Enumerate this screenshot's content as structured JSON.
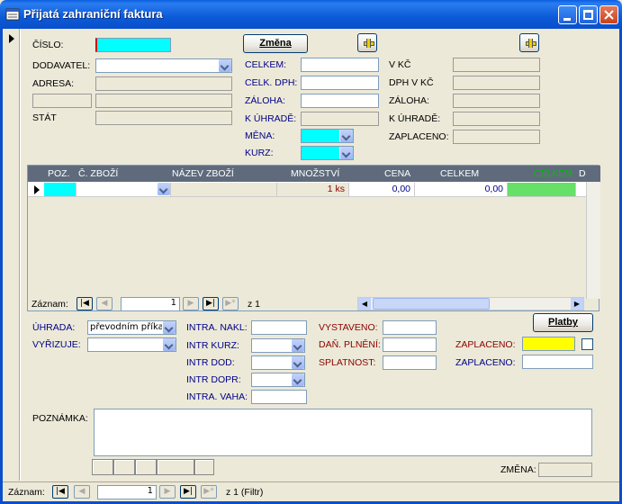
{
  "window": {
    "title": "Přijatá zahraniční faktura"
  },
  "header_left": {
    "cislo_label": "ČÍSLO:",
    "dodavatel_label": "DODAVATEL:",
    "adresa_label": "ADRESA:",
    "stat_label": "STÁT"
  },
  "header_mid": {
    "zmena_button": "Změna",
    "celkem_label": "CELKEM:",
    "celk_dph_label": "CELK. DPH:",
    "zaloha_label": "ZÁLOHA:",
    "k_uhrade_label": "K ÚHRADĚ:",
    "mena_label": "MĚNA:",
    "kurz_label": "KURZ:"
  },
  "header_right": {
    "v_kc_label": "V KČ",
    "dph_v_kc_label": "DPH V KČ",
    "zaloha_label": "ZÁLOHA:",
    "k_uhrade_label": "K ÚHRADĚ:",
    "zaplaceno_label": "ZAPLACENO:"
  },
  "items": {
    "columns": [
      "POZ.",
      "Č. ZBOŽÍ",
      "NÁZEV ZBOŽÍ",
      "MNOŽSTVÍ",
      "CENA",
      "CELKEM",
      "CELKEM",
      "D"
    ],
    "row": {
      "mnozstvi": "1 ks",
      "cena": "0,00",
      "celkem": "0,00"
    },
    "nav_label": "Záznam:",
    "nav_value": "1",
    "nav_of": "z  1"
  },
  "footer": {
    "uhrada_label": "ÚHRADA:",
    "uhrada_value": "převodním příka",
    "vyrizuje_label": "VYŘIZUJE:",
    "intra_nakl_label": "INTRA. NAKL:",
    "intr_kurz_label": "INTR KURZ:",
    "intr_dod_label": "INTR DOD:",
    "intr_dopr_label": "INTR DOPR:",
    "intra_vaha_label": "INTRA. VAHA:",
    "vystaveno_label": "VYSTAVENO:",
    "dan_plneni_label": "DAŇ. PLNĚNÍ:",
    "splatnost_label": "SPLATNOST:",
    "platby_button": "Platby",
    "zaplaceno1_label": "ZAPLACENO:",
    "zaplaceno2_label": "ZAPLACENO:",
    "poznamka_label": "POZNÁMKA:",
    "zmena_label": "ZMĚNA:"
  },
  "record_nav": {
    "label": "Záznam:",
    "value": "1",
    "of": "z  1 (Filtr)"
  },
  "colors": {
    "title_bar": "#0A5FE0",
    "cyan_field": "#00FFFF",
    "yellow_field": "#FFFF00",
    "grid_header": "#5F6B7C"
  }
}
